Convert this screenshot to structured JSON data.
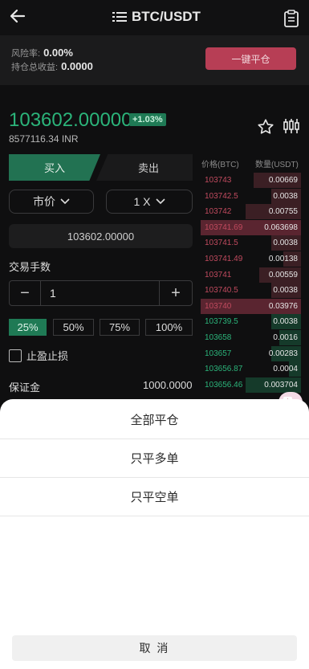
{
  "header": {
    "title": "BTC/USDT"
  },
  "risk": {
    "risk_label": "风险率:",
    "risk_value": "0.00%",
    "pnl_label": "持仓总收益:",
    "pnl_value": "0.0000",
    "close_all_label": "一键平仓"
  },
  "ticker": {
    "price": "103602.00000",
    "change": "+1.03%",
    "inr": "8577116.34 INR"
  },
  "trade": {
    "buy_label": "买入",
    "sell_label": "卖出",
    "order_type": "市价",
    "leverage": "1 X",
    "price_input": "103602.00000",
    "qty_label": "交易手数",
    "qty_value": "1",
    "minus": "−",
    "plus": "+",
    "percents": [
      "25%",
      "50%",
      "75%",
      "100%"
    ],
    "tpsl_label": "止盈止损",
    "margin_label": "保证金",
    "margin_value": "1000.0000"
  },
  "orderbook": {
    "col_price": "价格(BTC)",
    "col_qty": "数量(USDT)",
    "asks": [
      {
        "p": "103743",
        "q": "0.00669",
        "depth": 0.47
      },
      {
        "p": "103742.5",
        "q": "0.0038",
        "depth": 0.3
      },
      {
        "p": "103742",
        "q": "0.00755",
        "depth": 0.55
      },
      {
        "p": "103741.69",
        "q": "0.063698",
        "depth": 1.0
      },
      {
        "p": "103741.5",
        "q": "0.0038",
        "depth": 0.3
      },
      {
        "p": "103741.49",
        "q": "0.00138",
        "depth": 0.18
      },
      {
        "p": "103741",
        "q": "0.00559",
        "depth": 0.42
      },
      {
        "p": "103740.5",
        "q": "0.0038",
        "depth": 0.3
      },
      {
        "p": "103740",
        "q": "0.03976",
        "depth": 1.0
      }
    ],
    "bids": [
      {
        "p": "103739.5",
        "q": "0.0038",
        "depth": 0.3
      },
      {
        "p": "103658",
        "q": "0.0016",
        "depth": 0.22
      },
      {
        "p": "103657",
        "q": "0.00283",
        "depth": 0.3
      },
      {
        "p": "103656.87",
        "q": "0.0004",
        "depth": 0.12
      },
      {
        "p": "103656.46",
        "q": "0.003704",
        "depth": 0.55
      }
    ]
  },
  "sheet": {
    "items": [
      "全部平仓",
      "只平多单",
      "只平空单"
    ],
    "cancel": "取 消"
  },
  "colors": {
    "up": "#2bb47a",
    "down": "#c04a5e",
    "accent_red": "#b73e55"
  }
}
